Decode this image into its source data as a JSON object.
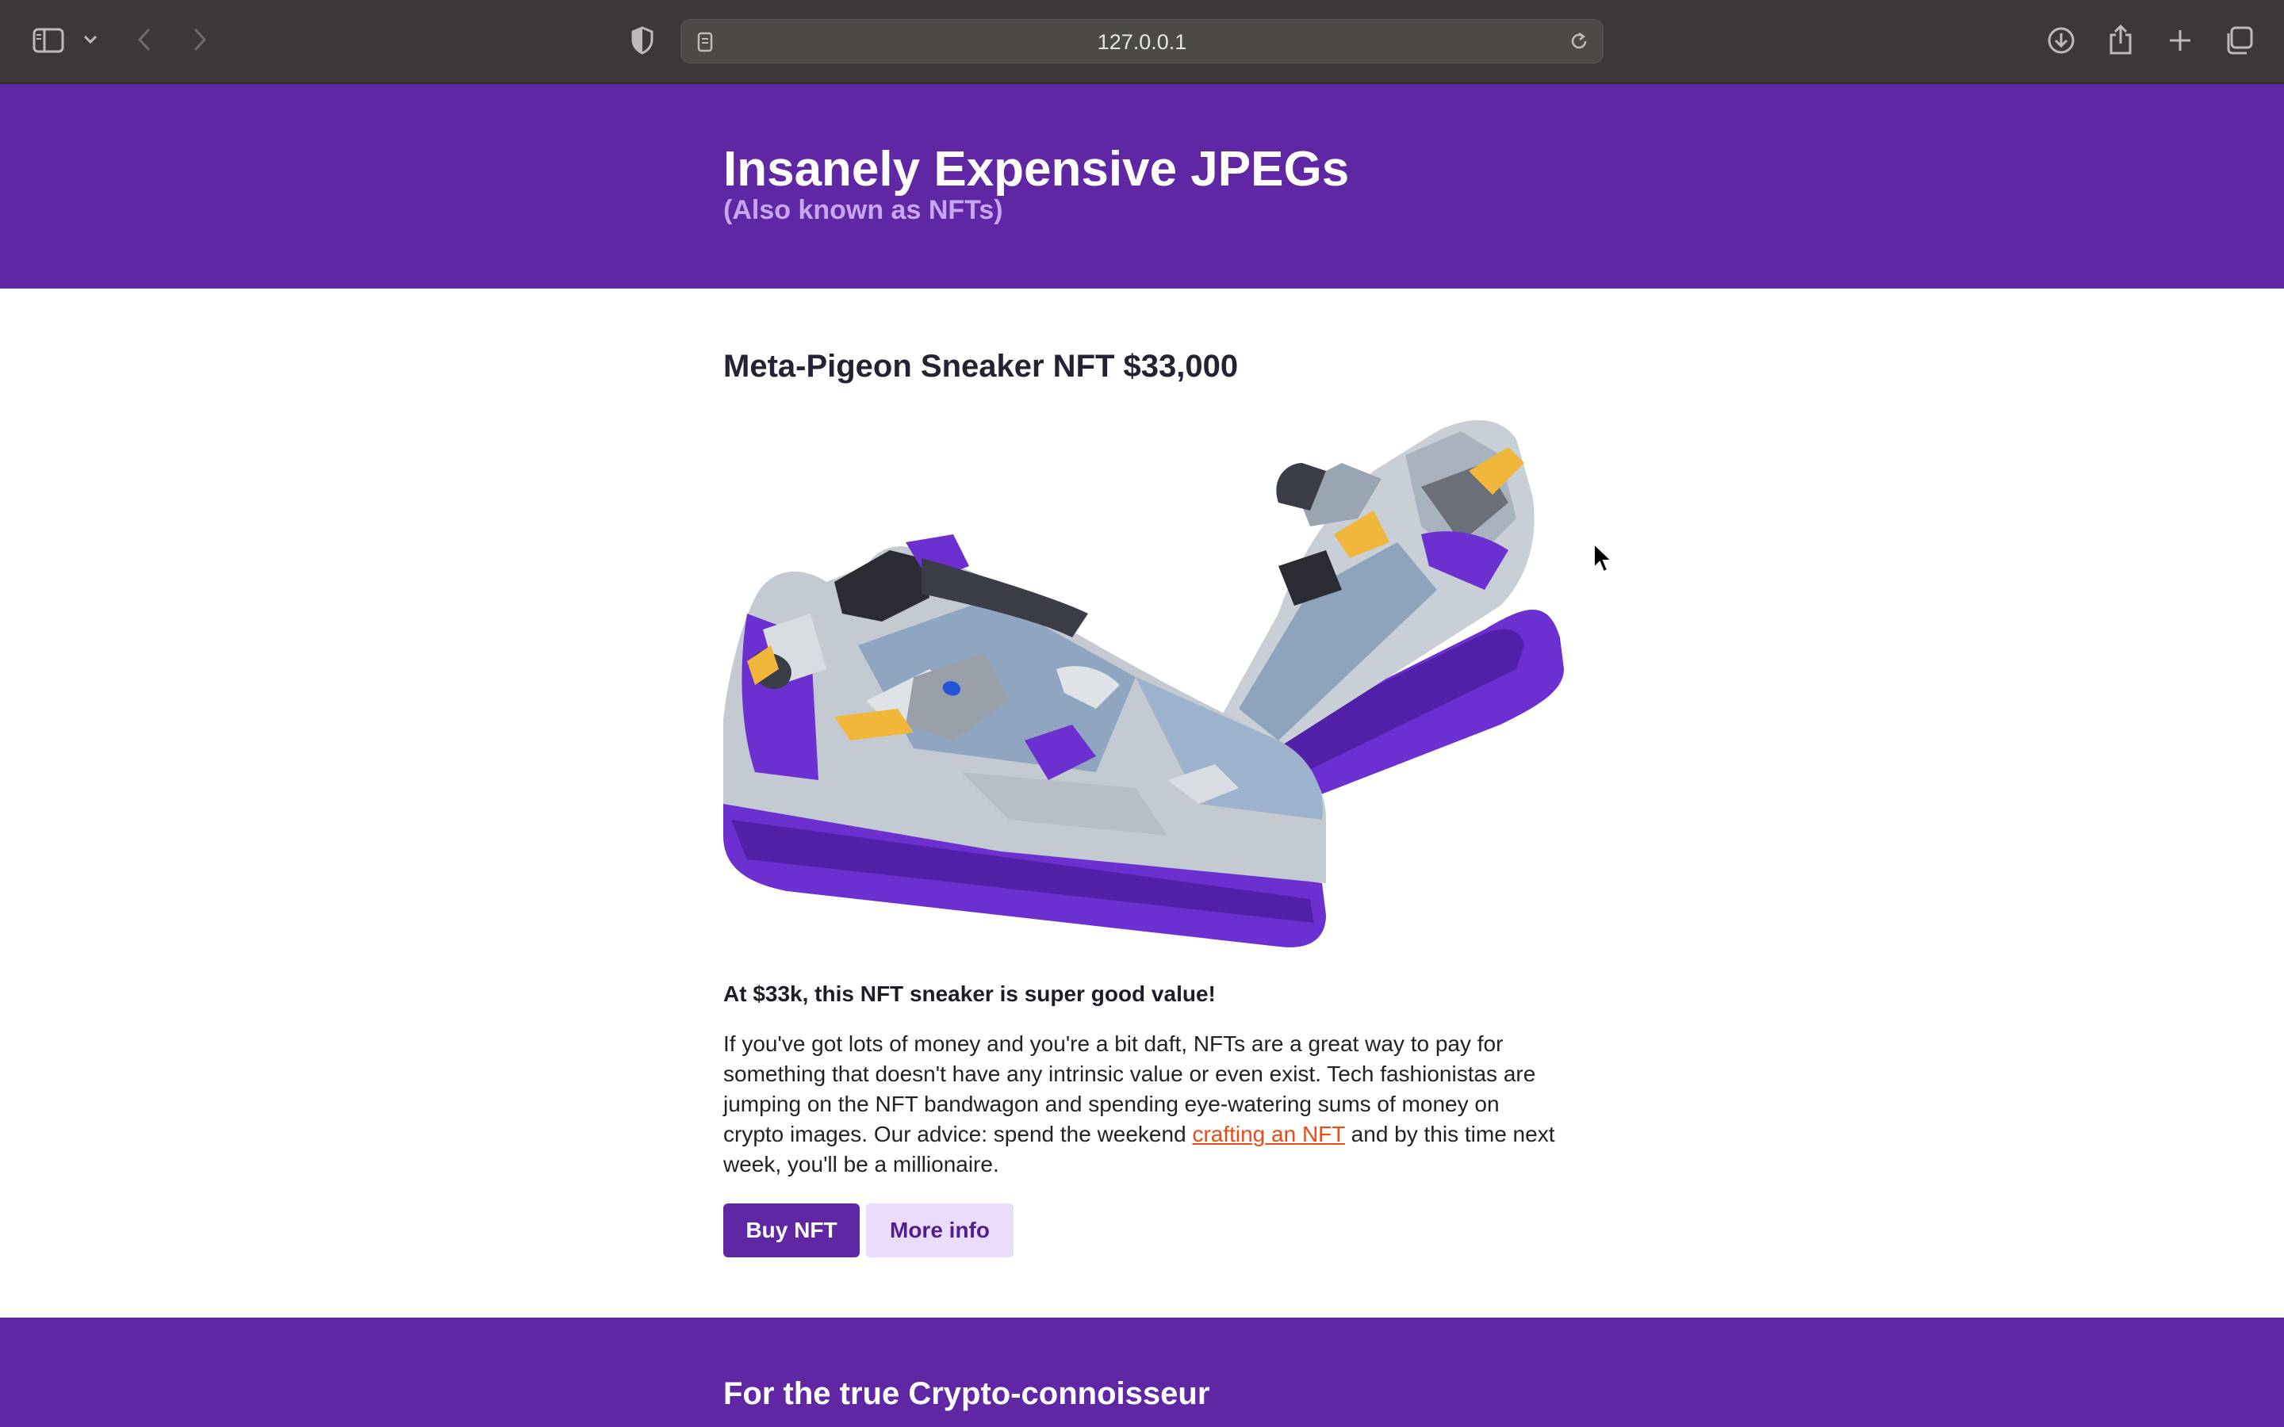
{
  "browser": {
    "url": "127.0.0.1",
    "icons": [
      "sidebar-icon",
      "chevron-down-icon",
      "back-icon",
      "forward-icon",
      "shield-icon",
      "page-icon",
      "reload-icon",
      "download-icon",
      "share-icon",
      "new-tab-icon",
      "tabs-overview-icon"
    ]
  },
  "header": {
    "title": "Insanely Expensive JPEGs",
    "subtitle": "(Also known as NFTs)"
  },
  "product": {
    "title": "Meta-Pigeon Sneaker NFT $33,000",
    "tagline": "At $33k, this NFT sneaker is super good value!",
    "description_before": "If you've got lots of money and you're a bit daft, NFTs are a great way to pay for something that doesn't have any intrinsic value or even exist. Tech fashionistas are jumping on the NFT bandwagon and spending eye-watering sums of money on crypto images. Our advice: spend the weekend ",
    "link_text": "crafting an NFT",
    "description_after": " and by this time next week, you'll be a millionaire.",
    "buy_label": "Buy NFT",
    "more_label": "More info"
  },
  "footer_section": {
    "title": "For the true Crypto-connoisseur"
  },
  "colors": {
    "brand_purple": "#5f27a4",
    "light_purple": "#ecdcfb",
    "link_orange": "#ea4a16",
    "subtitle_lavender": "#c7a6f2"
  }
}
